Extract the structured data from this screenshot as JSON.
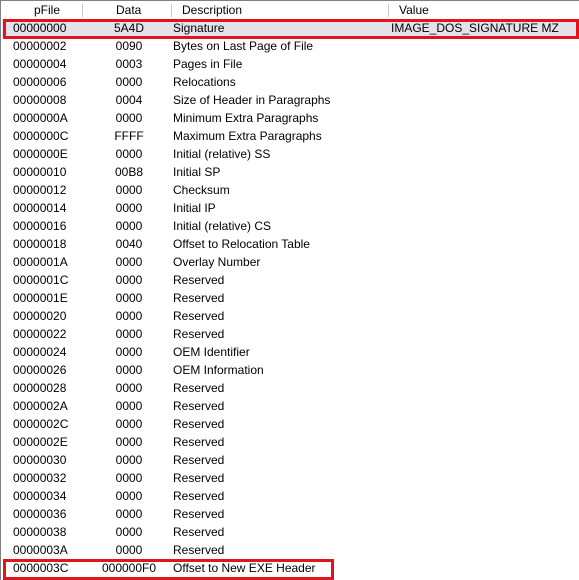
{
  "columns": [
    "pFile",
    "Data",
    "Description",
    "Value"
  ],
  "rows": [
    [
      "00000000",
      "5A4D",
      "Signature",
      "IMAGE_DOS_SIGNATURE MZ"
    ],
    [
      "00000002",
      "0090",
      "Bytes on Last Page of File",
      ""
    ],
    [
      "00000004",
      "0003",
      "Pages in File",
      ""
    ],
    [
      "00000006",
      "0000",
      "Relocations",
      ""
    ],
    [
      "00000008",
      "0004",
      "Size of Header in Paragraphs",
      ""
    ],
    [
      "0000000A",
      "0000",
      "Minimum Extra Paragraphs",
      ""
    ],
    [
      "0000000C",
      "FFFF",
      "Maximum Extra Paragraphs",
      ""
    ],
    [
      "0000000E",
      "0000",
      "Initial (relative) SS",
      ""
    ],
    [
      "00000010",
      "00B8",
      "Initial SP",
      ""
    ],
    [
      "00000012",
      "0000",
      "Checksum",
      ""
    ],
    [
      "00000014",
      "0000",
      "Initial IP",
      ""
    ],
    [
      "00000016",
      "0000",
      "Initial (relative) CS",
      ""
    ],
    [
      "00000018",
      "0040",
      "Offset to Relocation Table",
      ""
    ],
    [
      "0000001A",
      "0000",
      "Overlay Number",
      ""
    ],
    [
      "0000001C",
      "0000",
      "Reserved",
      ""
    ],
    [
      "0000001E",
      "0000",
      "Reserved",
      ""
    ],
    [
      "00000020",
      "0000",
      "Reserved",
      ""
    ],
    [
      "00000022",
      "0000",
      "Reserved",
      ""
    ],
    [
      "00000024",
      "0000",
      "OEM Identifier",
      ""
    ],
    [
      "00000026",
      "0000",
      "OEM Information",
      ""
    ],
    [
      "00000028",
      "0000",
      "Reserved",
      ""
    ],
    [
      "0000002A",
      "0000",
      "Reserved",
      ""
    ],
    [
      "0000002C",
      "0000",
      "Reserved",
      ""
    ],
    [
      "0000002E",
      "0000",
      "Reserved",
      ""
    ],
    [
      "00000030",
      "0000",
      "Reserved",
      ""
    ],
    [
      "00000032",
      "0000",
      "Reserved",
      ""
    ],
    [
      "00000034",
      "0000",
      "Reserved",
      ""
    ],
    [
      "00000036",
      "0000",
      "Reserved",
      ""
    ],
    [
      "00000038",
      "0000",
      "Reserved",
      ""
    ],
    [
      "0000003A",
      "0000",
      "Reserved",
      ""
    ],
    [
      "0000003C",
      "000000F0",
      "Offset to New EXE Header",
      ""
    ]
  ],
  "selected_row": 0,
  "highlight_color": "#e0141c"
}
